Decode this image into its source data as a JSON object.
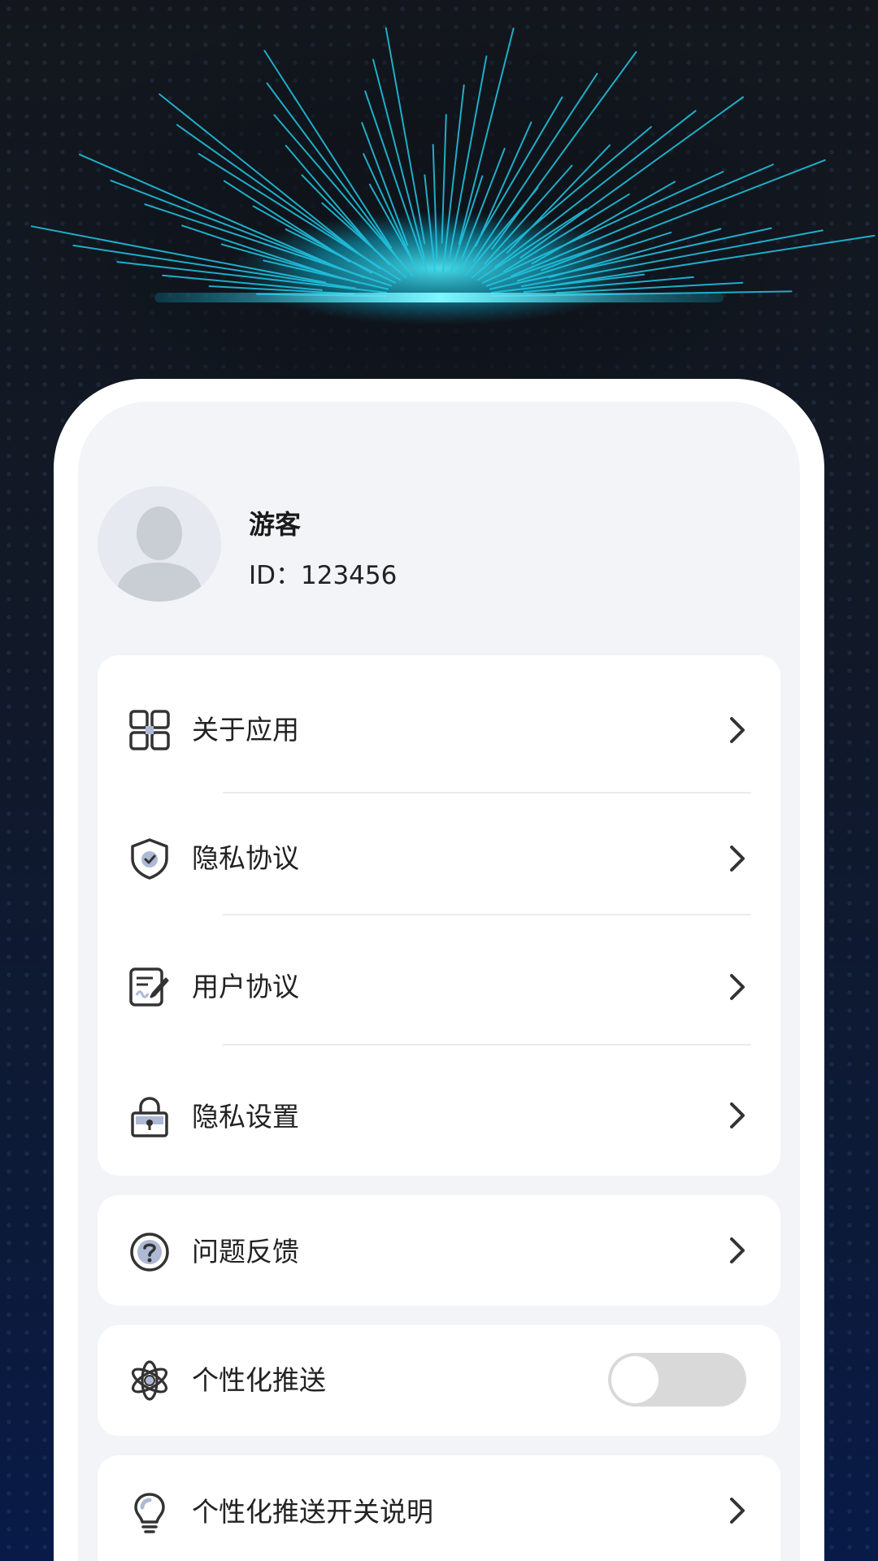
{
  "profile": {
    "name": "游客",
    "id_text": "ID：123456"
  },
  "menu_group_1": [
    {
      "label": "关于应用",
      "icon": "grid-apps-icon"
    },
    {
      "label": "隐私协议",
      "icon": "shield-check-icon"
    },
    {
      "label": "用户协议",
      "icon": "document-sign-icon"
    },
    {
      "label": "隐私设置",
      "icon": "lock-icon"
    }
  ],
  "feedback": {
    "label": "问题反馈",
    "icon": "question-circle-icon"
  },
  "personalized_push": {
    "label": "个性化推送",
    "icon": "atom-icon",
    "enabled": false
  },
  "push_explain": {
    "label": "个性化推送开关说明",
    "icon": "lightbulb-icon"
  },
  "colors": {
    "glow": "#19d6f0",
    "panel_bg": "#f2f4f8",
    "card_bg": "#ffffff",
    "toggle_off": "#d9d9d9"
  }
}
